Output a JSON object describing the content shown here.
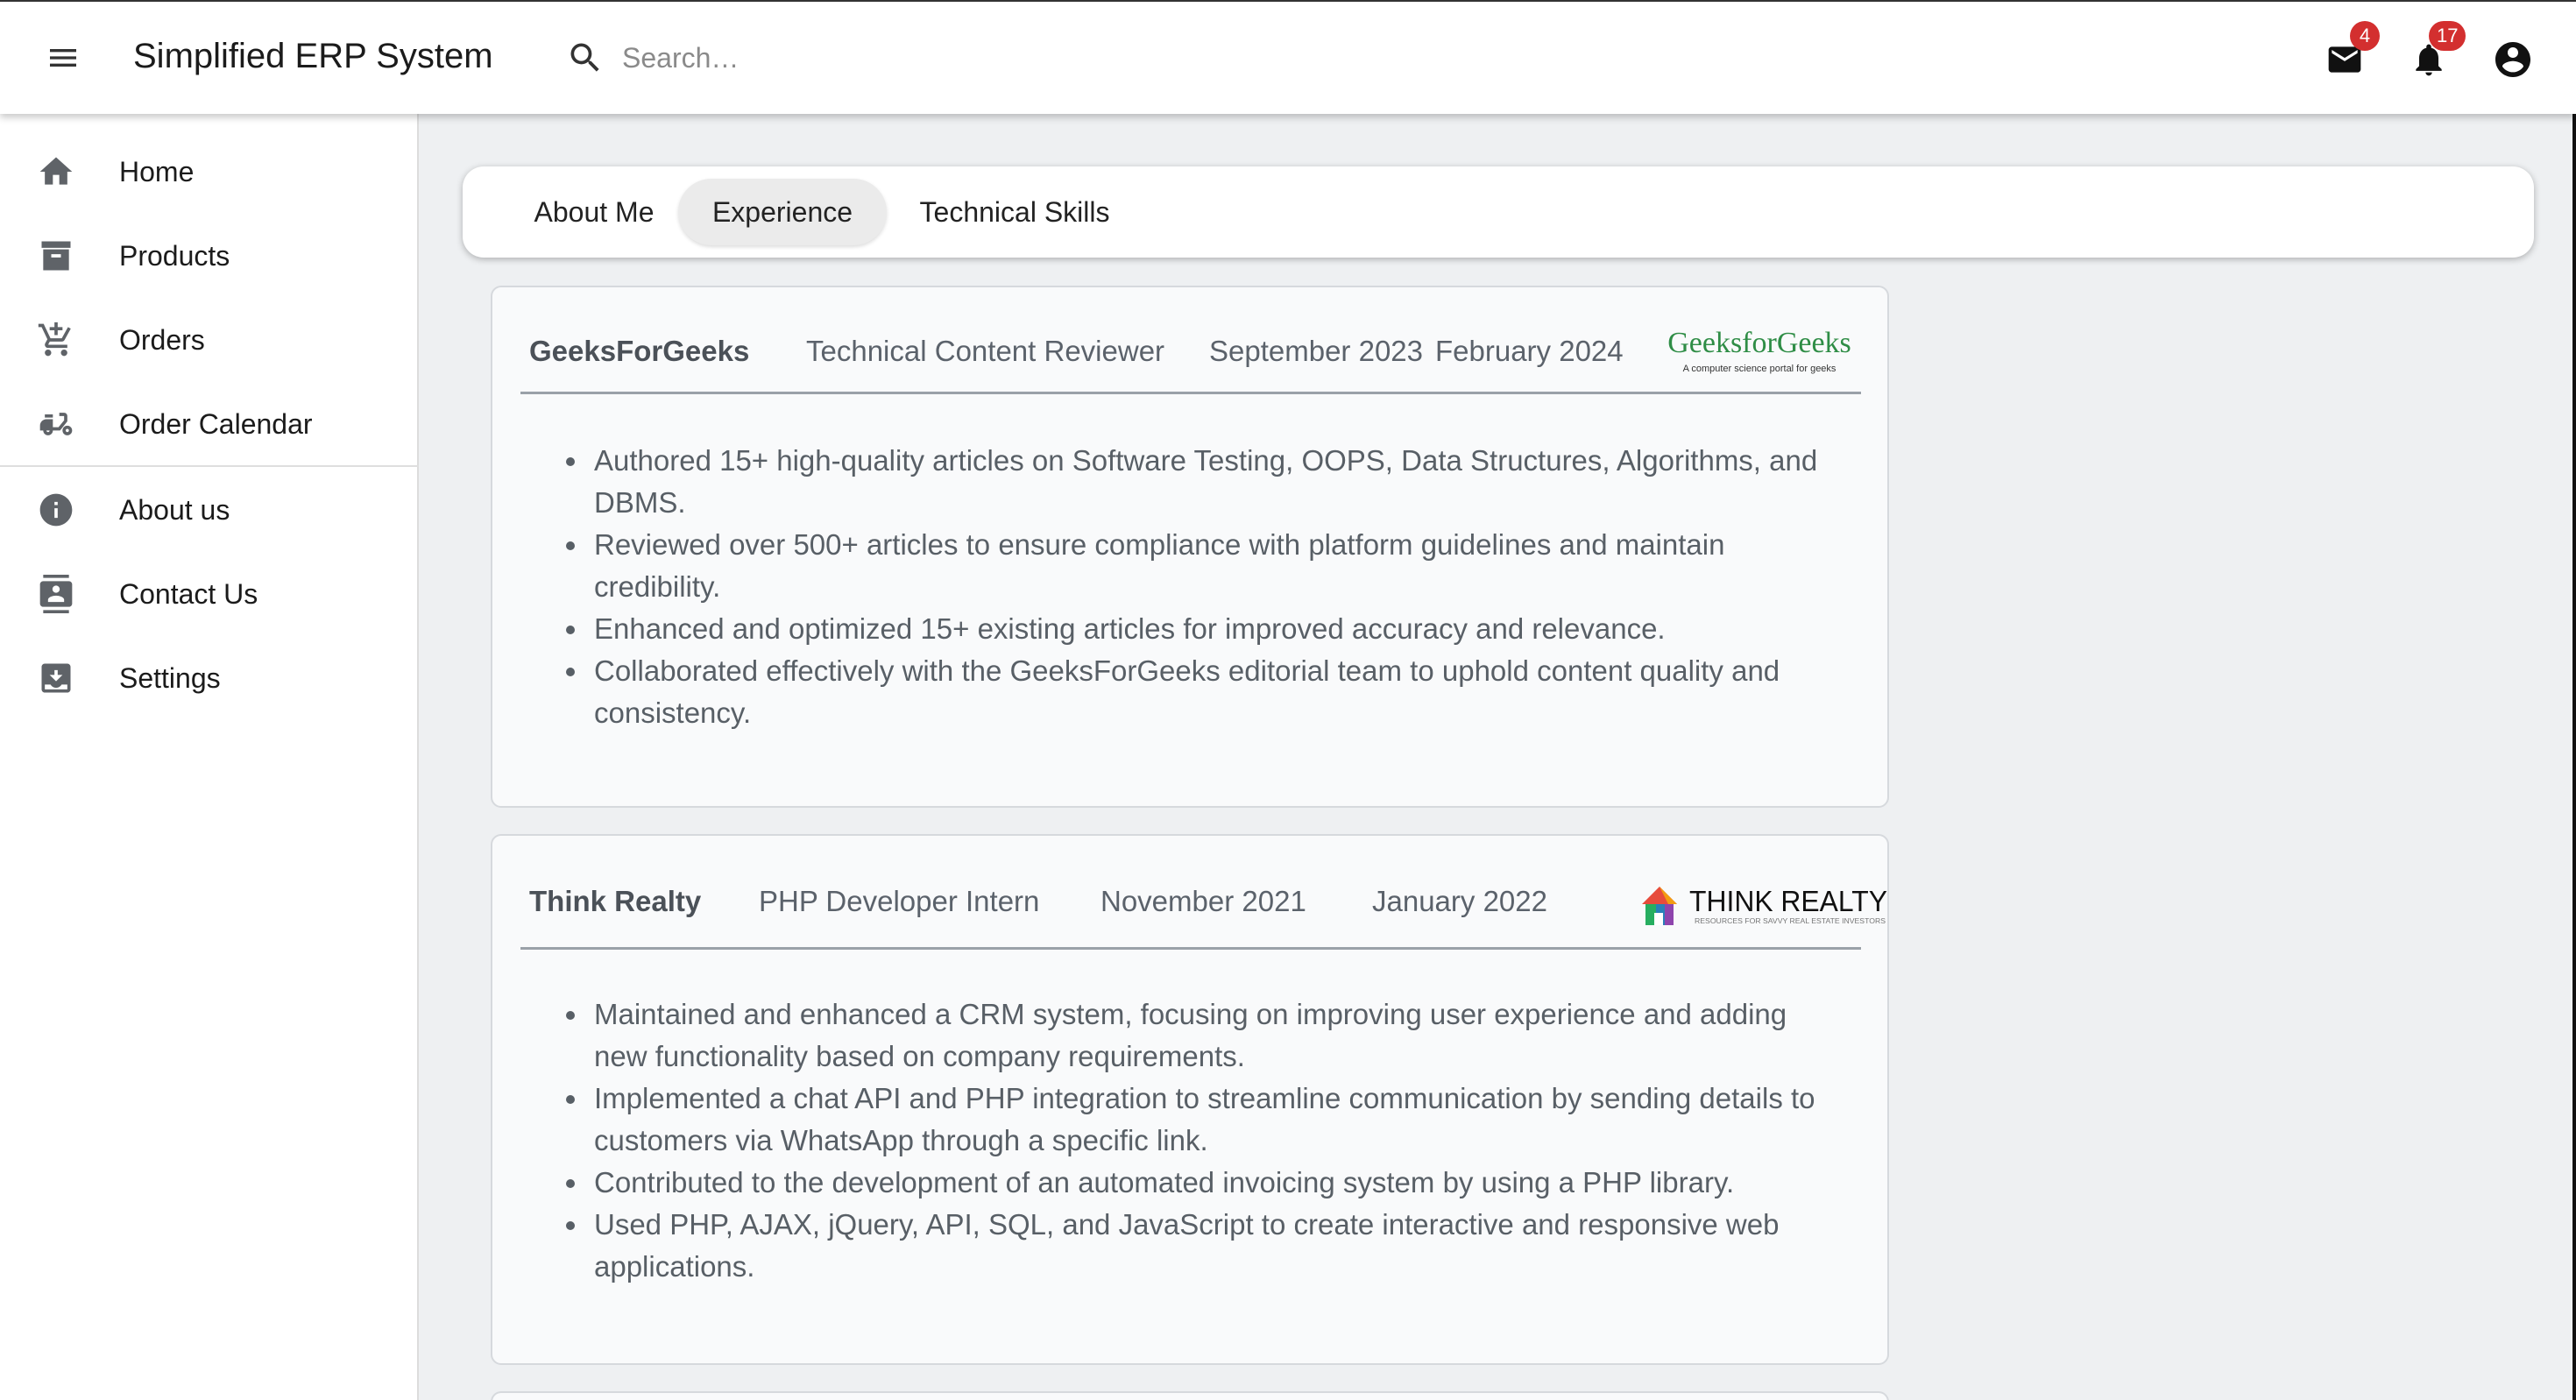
{
  "app": {
    "title": "Simplified ERP System",
    "search_placeholder": "Search…",
    "mail_badge": "4",
    "notification_badge": "17"
  },
  "sidebar": {
    "items": [
      {
        "label": "Home",
        "icon": "home-icon"
      },
      {
        "label": "Products",
        "icon": "archive-icon"
      },
      {
        "label": "Orders",
        "icon": "cart-icon"
      },
      {
        "label": "Order Calendar",
        "icon": "delivery-icon"
      },
      {
        "label": "About us",
        "icon": "info-icon"
      },
      {
        "label": "Contact Us",
        "icon": "contact-icon"
      },
      {
        "label": "Settings",
        "icon": "download-box-icon"
      }
    ]
  },
  "tabs": [
    {
      "label": "About Me",
      "active": false
    },
    {
      "label": "Experience",
      "active": true
    },
    {
      "label": "Technical Skills",
      "active": false
    }
  ],
  "experience": [
    {
      "company": "GeeksForGeeks",
      "role": "Technical Content Reviewer",
      "start": "September 2023",
      "end": "February 2024",
      "logo_text": "GeeksforGeeks",
      "logo_tagline": "A computer science portal for geeks",
      "bullets": [
        "Authored 15+ high-quality articles on Software Testing, OOPS, Data Structures, Algorithms, and DBMS.",
        "Reviewed over 500+ articles to ensure compliance with platform guidelines and maintain credibility.",
        "Enhanced and optimized 15+ existing articles for improved accuracy and relevance.",
        "Collaborated effectively with the GeeksForGeeks editorial team to uphold content quality and consistency."
      ]
    },
    {
      "company": "Think Realty",
      "role": "PHP Developer Intern",
      "start": "November 2021",
      "end": "January 2022",
      "logo_text": "THINK REALTY",
      "logo_tagline": "RESOURCES FOR SAVVY REAL ESTATE INVESTORS",
      "bullets": [
        "Maintained and enhanced a CRM system, focusing on improving user experience and adding new functionality based on company requirements.",
        "Implemented a chat API and PHP integration to streamline communication by sending details to customers via WhatsApp through a specific link.",
        "Contributed to the development of an automated invoicing system by using a PHP library.",
        "Used PHP, AJAX, jQuery, API, SQL, and JavaScript to create interactive and responsive web applications."
      ]
    }
  ],
  "colors": {
    "badge": "#d32f2f",
    "gfg_green": "#2f8d46",
    "background": "#eef0f2"
  }
}
